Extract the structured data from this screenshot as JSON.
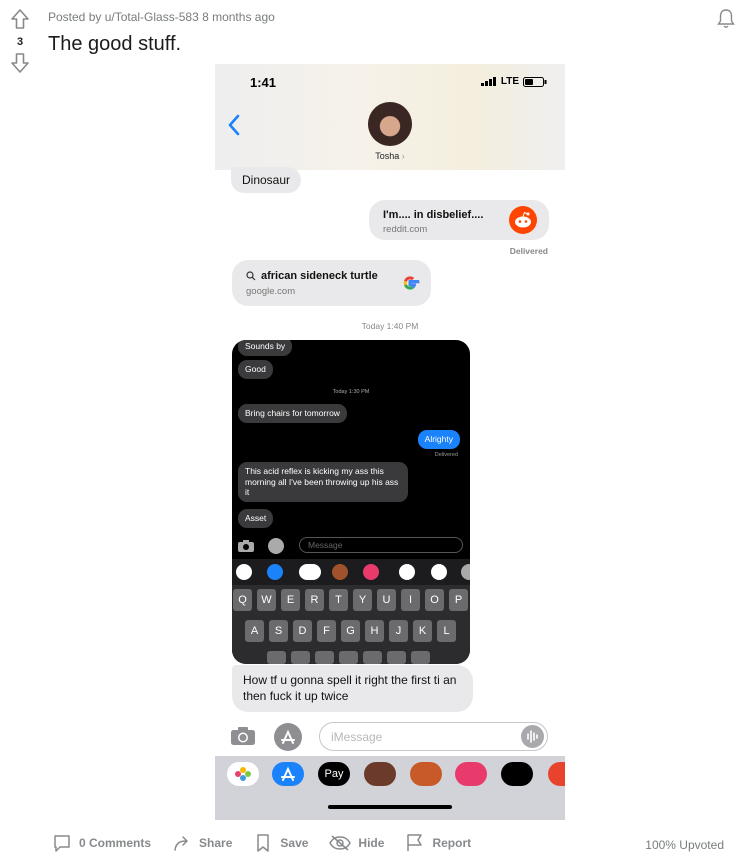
{
  "post": {
    "vote_count": "3",
    "meta": "Posted by u/Total-Glass-583 8 months ago",
    "title": "The good stuff."
  },
  "screenshot": {
    "status_time": "1:41",
    "network": "LTE",
    "contact_name": "Tosha",
    "messages": {
      "dinosaur": "Dinosaur",
      "reddit_link_title": "I'm.... in disbelief....",
      "reddit_link_domain": "reddit.com",
      "delivered": "Delivered",
      "google_link_title": "african sideneck turtle",
      "google_link_domain": "google.com",
      "timestamp": "Today 1:40 PM",
      "last_message": "How tf u gonna spell it right the first ti an then fuck it up twice"
    },
    "inner_screenshot": {
      "sounds_by": "Sounds by",
      "good": "Good",
      "timestamp": "Today 1:30 PM",
      "bring_chairs": "Bring chairs for tomorrow",
      "alrighty": "Alrighty",
      "delivered": "Delivered",
      "acid_reflex": "This acid reflex is kicking my ass this morning all I've been throwing up his ass it",
      "asset": "Asset",
      "input_placeholder": "Message",
      "keyboard_row1": [
        "Q",
        "W",
        "E",
        "R",
        "T",
        "Y",
        "U",
        "I",
        "O",
        "P"
      ],
      "keyboard_row2": [
        "A",
        "S",
        "D",
        "F",
        "G",
        "H",
        "J",
        "K",
        "L"
      ]
    },
    "input_placeholder": "iMessage",
    "apple_pay_label": "Pay"
  },
  "footer": {
    "comments": "0 Comments",
    "share": "Share",
    "save": "Save",
    "hide": "Hide",
    "report": "Report",
    "upvoted": "100% Upvoted"
  },
  "colors": {
    "imessage_blue": "#1a82fb",
    "received_bubble": "#e9e9eb",
    "reddit_orange": "#ff4500",
    "footer_gray": "#878a8c"
  }
}
